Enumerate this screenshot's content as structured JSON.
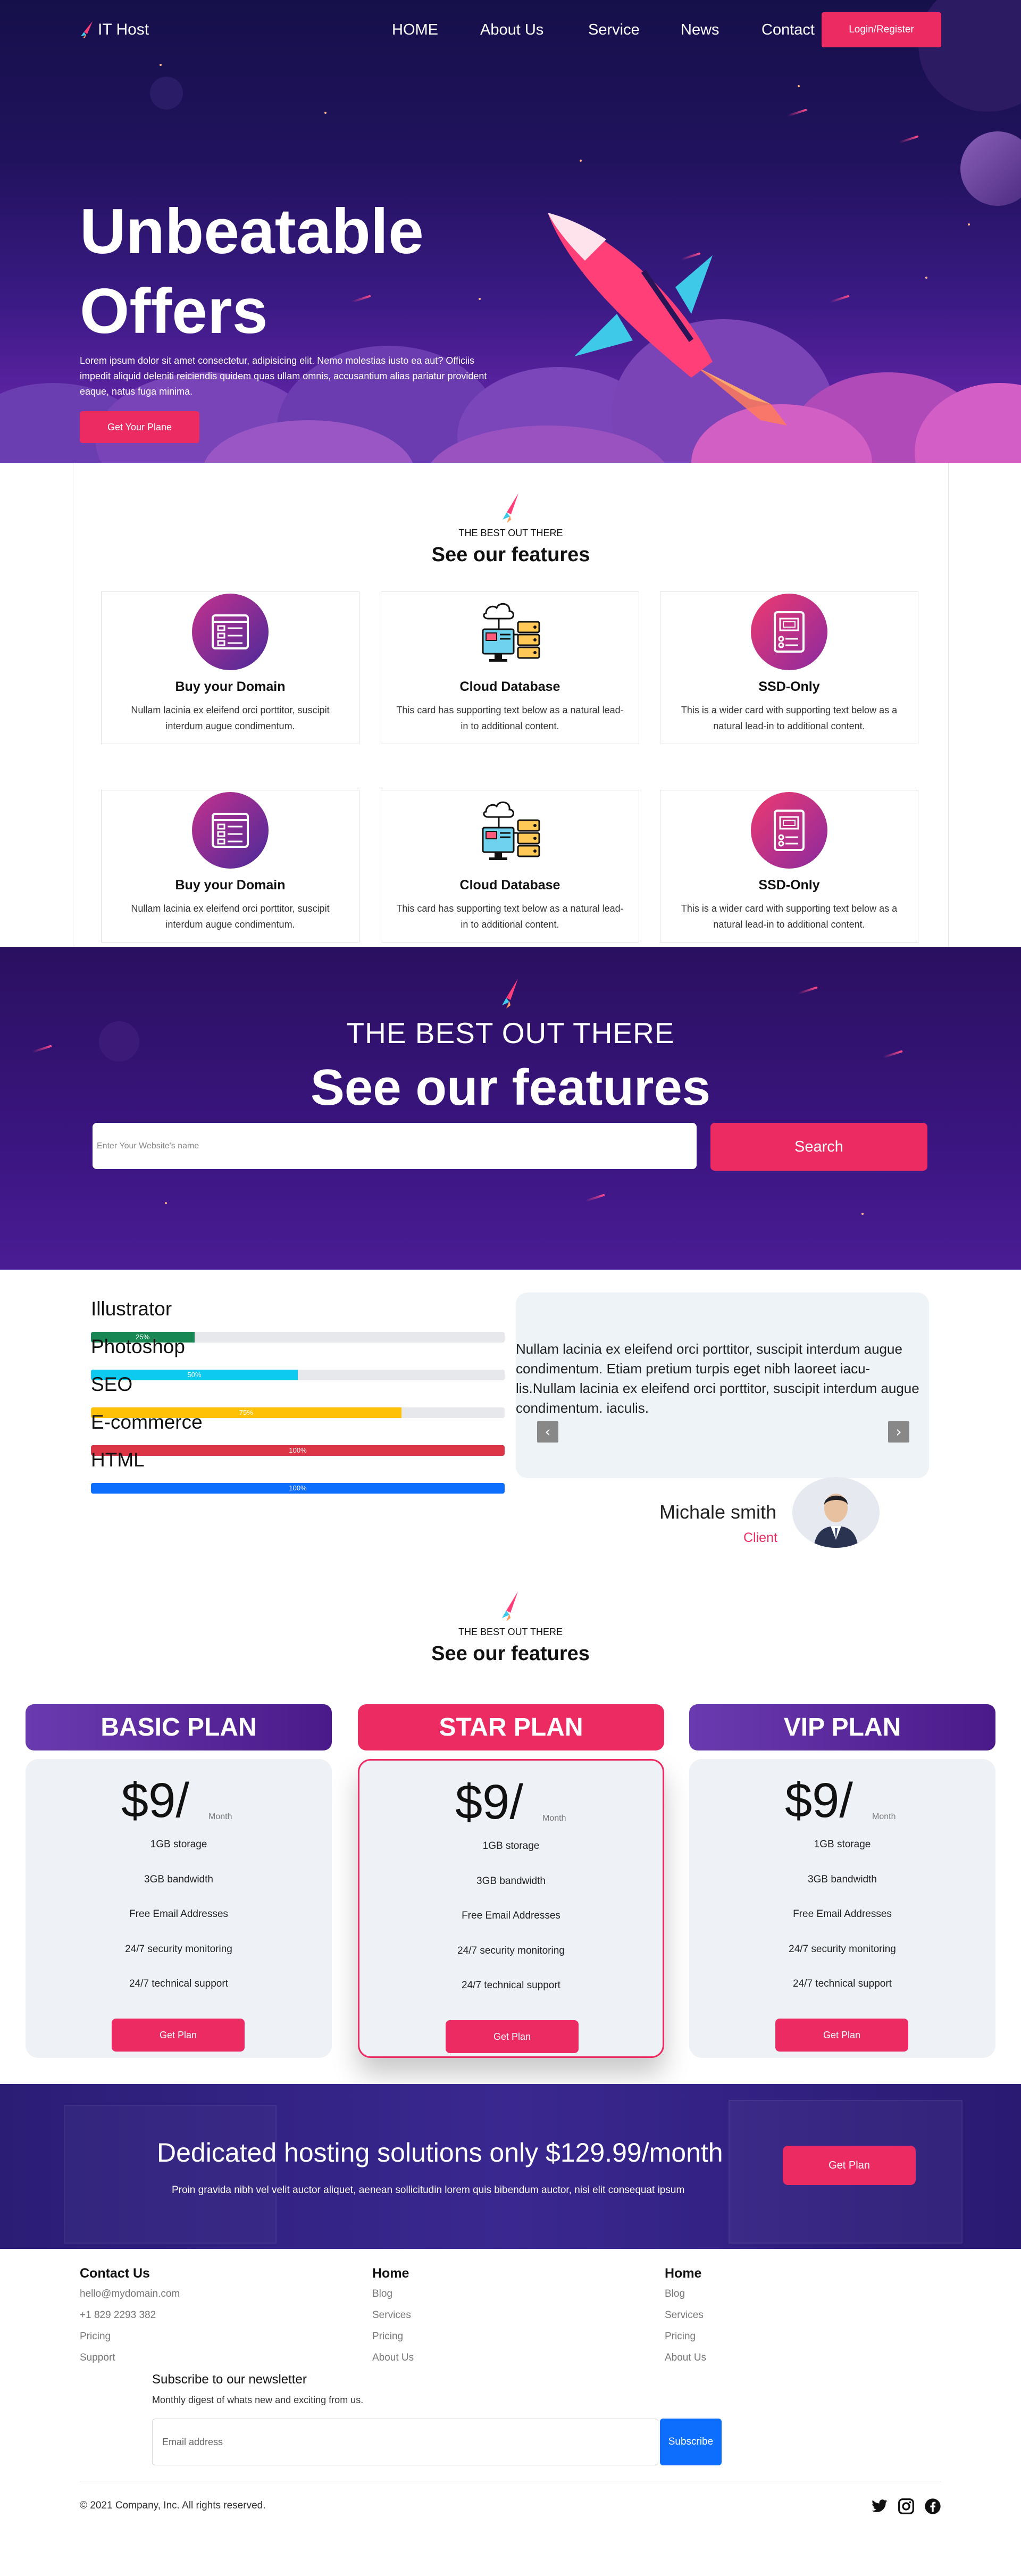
{
  "nav": {
    "logo_text": "IT Host",
    "links": [
      "HOME",
      "About Us",
      "Service",
      "News",
      "Contact"
    ],
    "login_label": "Login/Register"
  },
  "hero": {
    "title_line1": "Unbeatable",
    "title_line2": "Offers",
    "text": "Lorem ipsum dolor sit amet consectetur, adipisicing elit. Nemo molestias iusto ea aut? Officiis impedit aliquid deleniti reiciendis quidem quas ullam omnis, accusantium alias pariatur provident eaque, natus fuga minima.",
    "button_label": "Get Your Plane"
  },
  "features": {
    "kicker": "THE BEST OUT THERE",
    "title": "See our features",
    "cards": [
      {
        "title": "Buy your Domain",
        "text": "Nullam lacinia ex eleifend orci porttitor, suscipit interdum augue condimentum.",
        "icon": "domain-icon"
      },
      {
        "title": "Cloud Database",
        "text": "This card has supporting text below as a natural lead-in to additional content.",
        "icon": "cloud-database-icon"
      },
      {
        "title": "SSD-Only",
        "text": "This is a wider card with supporting text below as a natural lead-in to additional content.",
        "icon": "ssd-icon"
      },
      {
        "title": "Buy your Domain",
        "text": "Nullam lacinia ex eleifend orci porttitor, suscipit interdum augue condimentum.",
        "icon": "domain-icon"
      },
      {
        "title": "Cloud Database",
        "text": "This card has supporting text below as a natural lead-in to additional content.",
        "icon": "cloud-database-icon"
      },
      {
        "title": "SSD-Only",
        "text": "This is a wider card with supporting text below as a natural lead-in to additional content.",
        "icon": "ssd-icon"
      }
    ]
  },
  "search": {
    "kicker": "THE BEST OUT THERE",
    "title": "See our features",
    "placeholder": "Enter Your Website's name",
    "button_label": "Search"
  },
  "skills": [
    {
      "name": "Illustrator",
      "percent": 25,
      "label": "25%",
      "color": "#198754"
    },
    {
      "name": "Photoshop",
      "percent": 50,
      "label": "50%",
      "color": "#0dcaf0"
    },
    {
      "name": "SEO",
      "percent": 75,
      "label": "75%",
      "color": "#ffc107"
    },
    {
      "name": "E-commerce",
      "percent": 100,
      "label": "100%",
      "color": "#dc3545"
    },
    {
      "name": "HTML",
      "percent": 100,
      "label": "100%",
      "color": "#0d6efd"
    }
  ],
  "testimonial": {
    "text": "Nullam lacinia ex eleifend orci porttitor, suscipit interdum augue condimentum. Etiam pretium turpis eget nibh laoreet iacu-lis.Nullam lacinia ex eleifend orci porttitor, suscipit interdum augue condimentum. iaculis.",
    "name": "Michale smith",
    "role": "Client",
    "prev": "‹",
    "next": "›"
  },
  "pricing": {
    "kicker": "THE BEST OUT THERE",
    "title": "See our features",
    "plans": [
      {
        "name": "BASIC PLAN",
        "price": "$9/",
        "period": "Month",
        "features": [
          "1GB storage",
          "3GB bandwidth",
          "Free Email Addresses",
          "24/7 security monitoring",
          "24/7 technical support"
        ],
        "button": "Get Plan",
        "header_color": "#5a2aa0",
        "highlighted": false
      },
      {
        "name": "STAR PLAN",
        "price": "$9/",
        "period": "Month",
        "features": [
          "1GB storage",
          "3GB bandwidth",
          "Free Email Addresses",
          "24/7 security monitoring",
          "24/7 technical support"
        ],
        "button": "Get Plan",
        "header_color": "#ec2b63",
        "highlighted": true
      },
      {
        "name": "VIP PLAN",
        "price": "$9/",
        "period": "Month",
        "features": [
          "1GB storage",
          "3GB bandwidth",
          "Free Email Addresses",
          "24/7 security monitoring",
          "24/7 technical support"
        ],
        "button": "Get Plan",
        "header_color": "#5a2aa0",
        "highlighted": false
      }
    ]
  },
  "cta": {
    "title": "Dedicated hosting solutions only $129.99/month",
    "subtitle": "Proin gravida nibh vel velit auctor aliquet, aenean sollicitudin lorem quis bibendum auctor, nisi elit consequat ipsum",
    "button": "Get Plan"
  },
  "footer": {
    "col1": {
      "title": "Contact Us",
      "links": [
        "hello@mydomain.com",
        "+1 829 2293 382",
        "Pricing",
        "Support"
      ]
    },
    "col2": {
      "title": "Home",
      "links": [
        "Blog",
        "Services",
        "Pricing",
        "About Us"
      ]
    },
    "col3": {
      "title": "Home",
      "links": [
        "Blog",
        "Services",
        "Pricing",
        "About Us"
      ]
    },
    "newsletter_title": "Subscribe to our newsletter",
    "newsletter_sub": "Monthly digest of whats new and exciting from us.",
    "email_placeholder": "Email address",
    "subscribe": "Subscribe",
    "copyright": "© 2021 Company, Inc. All rights reserved.",
    "social": [
      "twitter-icon",
      "instagram-icon",
      "facebook-icon"
    ]
  },
  "colors": {
    "accent": "#ec2b63",
    "purple": "#5a2aa0",
    "hero_dark": "#15104a"
  }
}
